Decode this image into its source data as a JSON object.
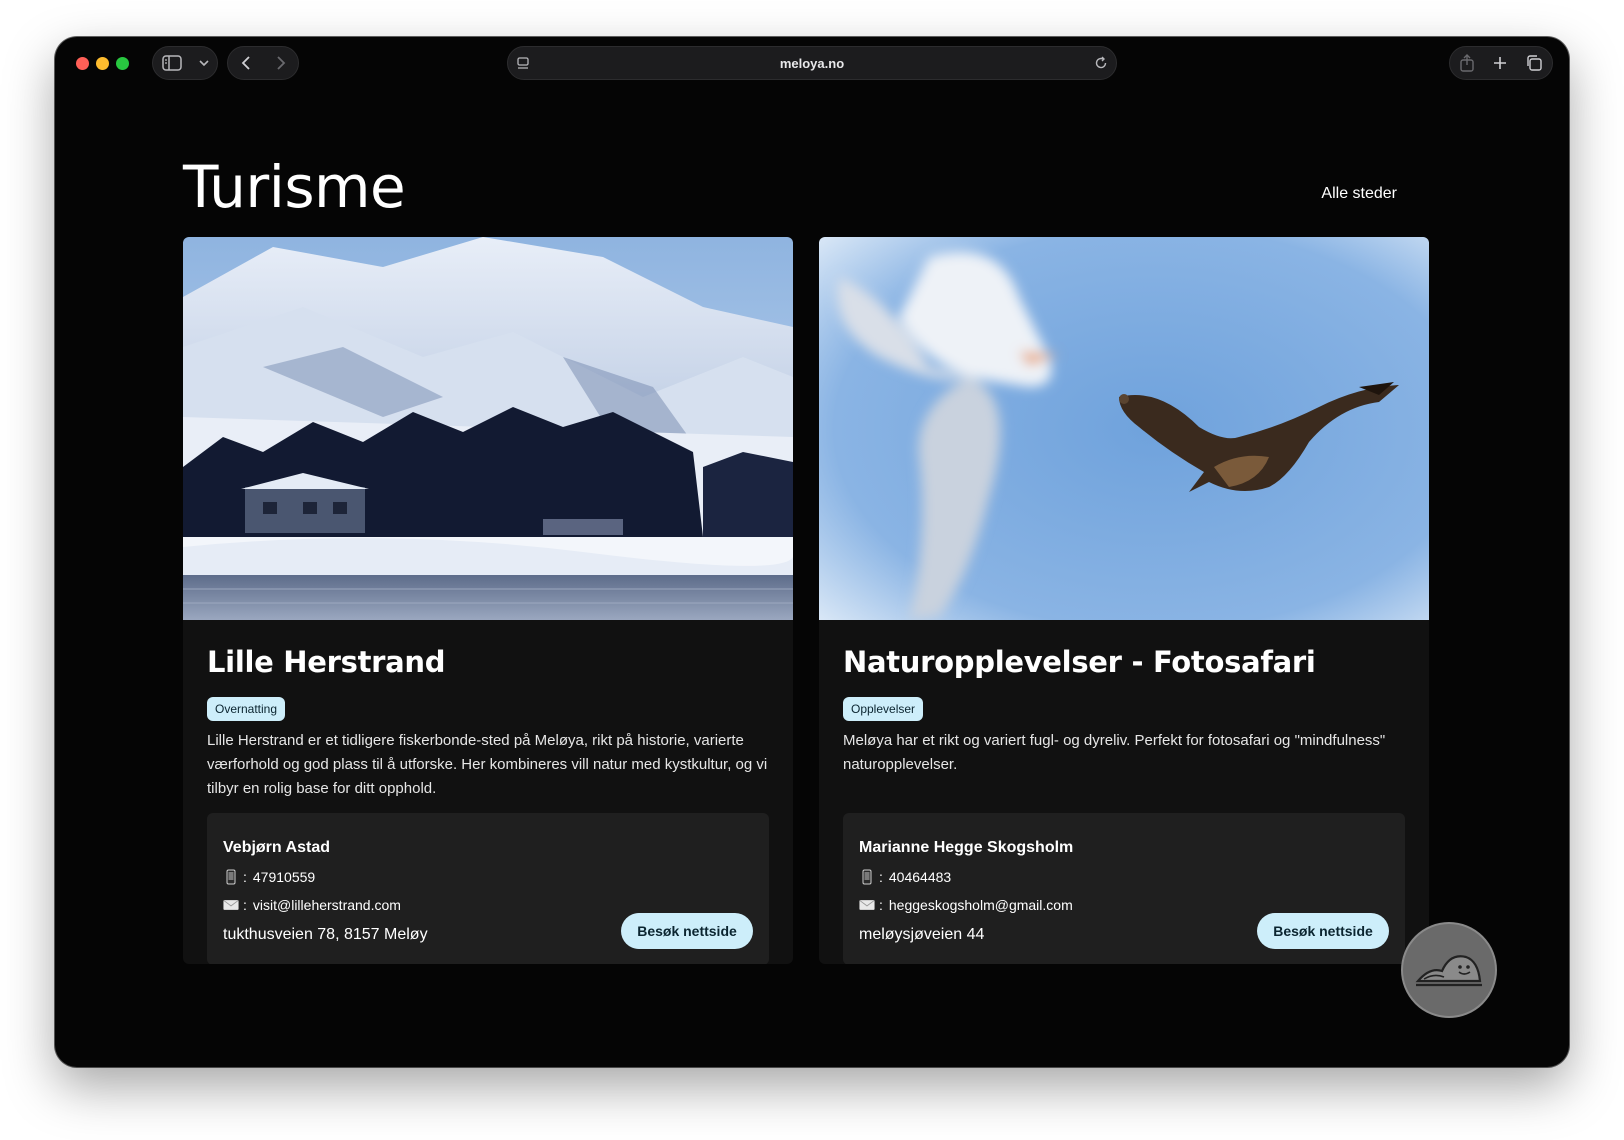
{
  "browser": {
    "url": "meloya.no"
  },
  "page": {
    "title": "Turisme",
    "all_places_link": "Alle steder"
  },
  "cards": [
    {
      "title": "Lille Herstrand",
      "tag": "Overnatting",
      "description": "Lille Herstrand er et tidligere fiskerbonde-sted på Meløya, rikt på historie, varierte værforhold og god plass til å utforske. Her kombineres vill natur med kystkultur, og vi tilbyr en rolig base for ditt opphold.",
      "contact": {
        "name": "Vebjørn Astad",
        "phone": "47910559",
        "email": "visit@lilleherstrand.com",
        "address": "tukthusveien 78, 8157 Meløy"
      },
      "button": "Besøk nettside"
    },
    {
      "title": "Naturopplevelser - Fotosafari",
      "tag": "Opplevelser",
      "description": "Meløya har et rikt og variert fugl- og dyreliv. Perfekt for fotosafari og \"mindfulness\" naturopplevelser.",
      "contact": {
        "name": "Marianne Hegge Skogsholm",
        "phone": "40464483",
        "email": "heggeskogsholm@gmail.com",
        "address": "meløysjøveien 44"
      },
      "button": "Besøk nettside"
    }
  ],
  "icons": {
    "phone": "phone-icon",
    "email": "envelope-icon",
    "mascot": "mascot-icon"
  },
  "colors": {
    "background": "#050505",
    "card": "#111111",
    "contact_box": "#1f1f1f",
    "accent": "#cdeefa"
  }
}
